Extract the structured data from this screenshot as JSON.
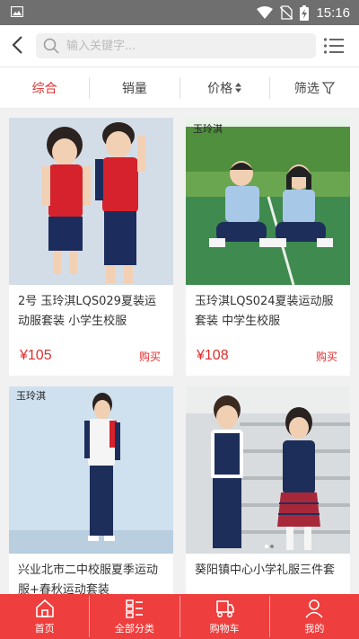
{
  "status_bar": {
    "time": "15:16"
  },
  "search": {
    "placeholder": "输入关键字..."
  },
  "sort_tabs": [
    {
      "label": "综合",
      "active": true
    },
    {
      "label": "销量",
      "active": false
    },
    {
      "label": "价格",
      "active": false
    },
    {
      "label": "筛选",
      "active": false
    }
  ],
  "products": [
    {
      "title": "2号 玉玲淇LQS029夏装运动服套装 小学生校服",
      "price": "¥105",
      "buy_label": "购买"
    },
    {
      "title": "玉玲淇LQS024夏装运动服套装 中学生校服",
      "price": "¥108",
      "buy_label": "购买"
    },
    {
      "title": "兴业北市二中校服夏季运动服+春秋运动套装",
      "price": "",
      "buy_label": ""
    },
    {
      "title": "葵阳镇中心小学礼服三件套",
      "price": "",
      "buy_label": ""
    }
  ],
  "watermark": "玉玲淇",
  "bottom_nav": [
    {
      "label": "首页",
      "icon": "home-icon"
    },
    {
      "label": "全部分类",
      "icon": "category-icon"
    },
    {
      "label": "购物车",
      "icon": "cart-icon"
    },
    {
      "label": "我的",
      "icon": "user-icon"
    }
  ],
  "colors": {
    "accent": "#e02e2e",
    "nav_bg": "#ef3e3e",
    "status_bg": "#6f6f6f"
  }
}
